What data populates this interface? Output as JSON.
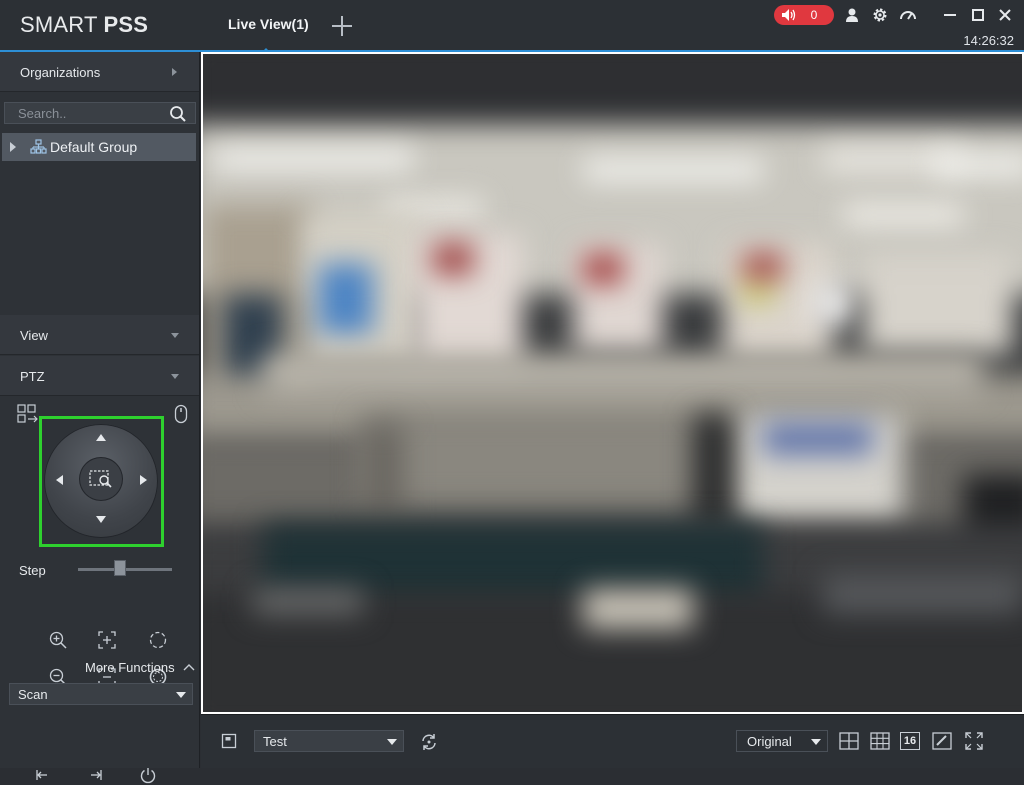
{
  "app": {
    "logo_regular": "SMART ",
    "logo_bold": "PSS"
  },
  "tabs": [
    {
      "label": "Live View(1)"
    }
  ],
  "header": {
    "alarm_count": "0",
    "clock": "14:26:32",
    "alarm_color": "#e0383f",
    "accent_color": "#2d8fd6"
  },
  "sidebar": {
    "organizations_label": "Organizations",
    "search_placeholder": "Search..",
    "tree": [
      {
        "label": "Default Group"
      }
    ],
    "view_label": "View",
    "ptz_label": "PTZ",
    "ptz": {
      "step_label": "Step",
      "step_value": 0.45,
      "highlight_color": "#2ed12e",
      "more_functions_label": "More Functions",
      "function_select": "Scan"
    }
  },
  "toolbar": {
    "view_select": "Test",
    "ratio_select": "Original",
    "grid16_label": "16"
  }
}
